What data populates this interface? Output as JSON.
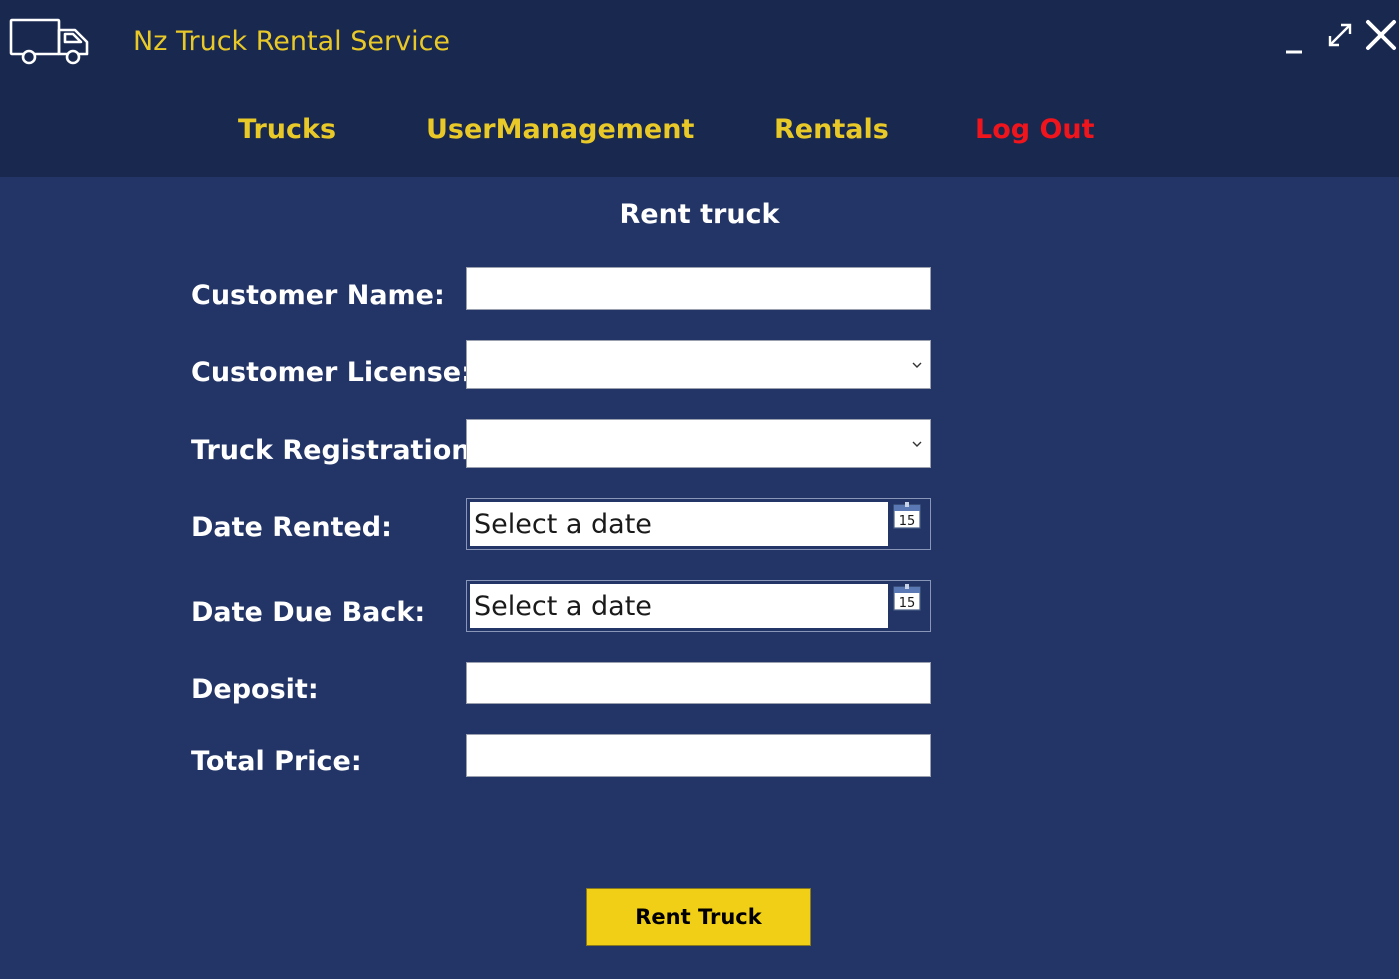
{
  "window": {
    "title": "Nz Truck Rental Service",
    "controls": [
      "minimize-icon",
      "maximize-icon",
      "close-icon"
    ]
  },
  "nav": {
    "items": [
      {
        "label": "Trucks",
        "color": "#e8c928"
      },
      {
        "label": "UserManagement",
        "color": "#e8c928"
      },
      {
        "label": "Rentals",
        "color": "#e8c928"
      },
      {
        "label": "Log Out",
        "color": "#f0151c"
      }
    ]
  },
  "form": {
    "title": "Rent truck",
    "customer_name": {
      "label": "Customer Name:",
      "value": ""
    },
    "customer_license": {
      "label": "Customer License:",
      "selected": ""
    },
    "truck_registration": {
      "label": "Truck Registration:",
      "selected": ""
    },
    "date_rented": {
      "label": "Date Rented:",
      "placeholder": "Select a date",
      "calendar_day": "15"
    },
    "date_due_back": {
      "label": "Date Due Back:",
      "placeholder": "Select a date",
      "calendar_day": "15"
    },
    "deposit": {
      "label": "Deposit:",
      "value": ""
    },
    "total_price": {
      "label": "Total Price:",
      "value": ""
    },
    "submit_label": "Rent Truck"
  },
  "colors": {
    "header_bg": "#18284f",
    "body_bg": "#233567",
    "accent_yellow": "#e8c928",
    "button_yellow": "#f2cf17",
    "logout_red": "#f0151c"
  }
}
